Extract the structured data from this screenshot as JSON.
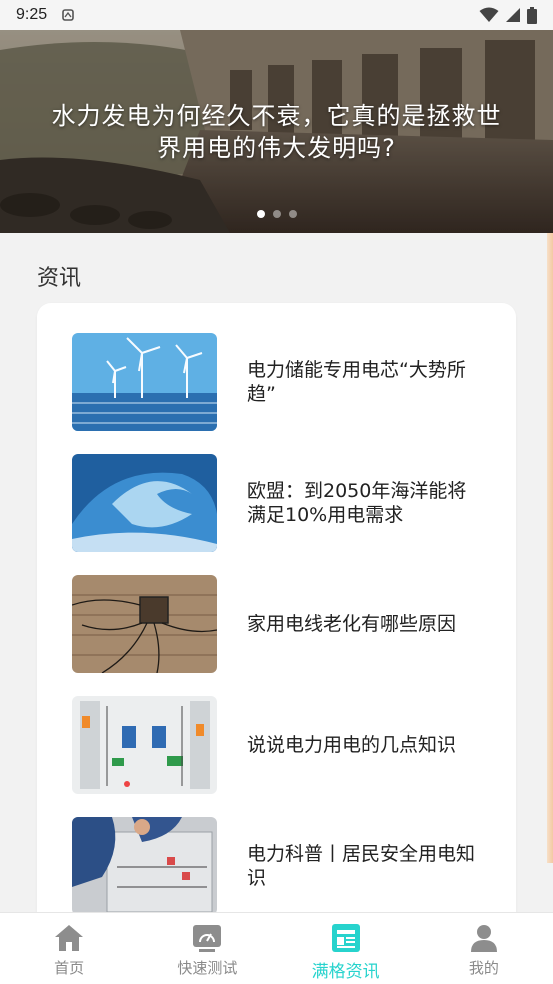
{
  "status_bar": {
    "time": "9:25"
  },
  "banner": {
    "title": "水力发电为何经久不衰，它真的是拯救世界用电的伟大发明吗?",
    "page_count": 3,
    "active_index": 0
  },
  "section": {
    "title": "资讯"
  },
  "news": [
    {
      "title": "电力储能专用电芯“大势所趋”",
      "thumb": "wind-turbines"
    },
    {
      "title": "欧盟：到2050年海洋能将满足10%用电需求",
      "thumb": "ocean-wave"
    },
    {
      "title": "家用电线老化有哪些原因",
      "thumb": "old-wiring"
    },
    {
      "title": "说说电力用电的几点知识",
      "thumb": "electrical-panel"
    },
    {
      "title": "电力科普丨居民安全用电知识",
      "thumb": "workers-panel"
    }
  ],
  "bottom_nav": [
    {
      "label": "首页",
      "icon": "home-icon",
      "active": false
    },
    {
      "label": "快速测试",
      "icon": "speedometer-icon",
      "active": false
    },
    {
      "label": "满格资讯",
      "icon": "news-icon",
      "active": true
    },
    {
      "label": "我的",
      "icon": "user-icon",
      "active": false
    }
  ],
  "colors": {
    "accent": "#27d3cd",
    "inactive": "#8a8a8a"
  }
}
